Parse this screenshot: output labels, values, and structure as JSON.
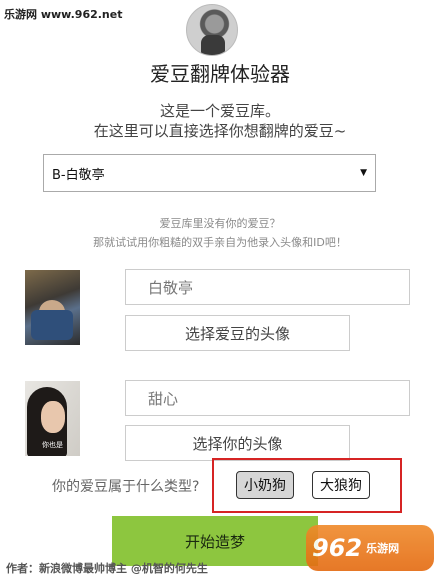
{
  "watermark": {
    "top_text": "乐游网 www.962.net",
    "logo_number": "962",
    "logo_text": "乐游网"
  },
  "header": {
    "title": "爱豆翻牌体验器",
    "subtitle_line1": "这是一个爱豆库。",
    "subtitle_line2": "在这里可以直接选择你想翻牌的爱豆~"
  },
  "idol_select": {
    "selected": "B-白敬亭",
    "arrow_icon": "triangle-down"
  },
  "hints": {
    "line1": "爱豆库里没有你的爱豆？",
    "line2": "那就试试用你粗糙的双手亲自为他录入头像和ID吧！"
  },
  "idol": {
    "name_value": "白敬亭",
    "avatar_button": "选择爱豆的头像"
  },
  "user": {
    "name_value": "甜心",
    "photo_caption": "你也是",
    "avatar_button": "选择你的头像"
  },
  "type_question": {
    "label": "你的爱豆属于什么类型?",
    "options": [
      "小奶狗",
      "大狼狗"
    ],
    "selected": "小奶狗"
  },
  "start_button": {
    "label": "开始造梦"
  },
  "footer": {
    "author": "作者：新浪微博最帅博主 @机智的何先生"
  }
}
